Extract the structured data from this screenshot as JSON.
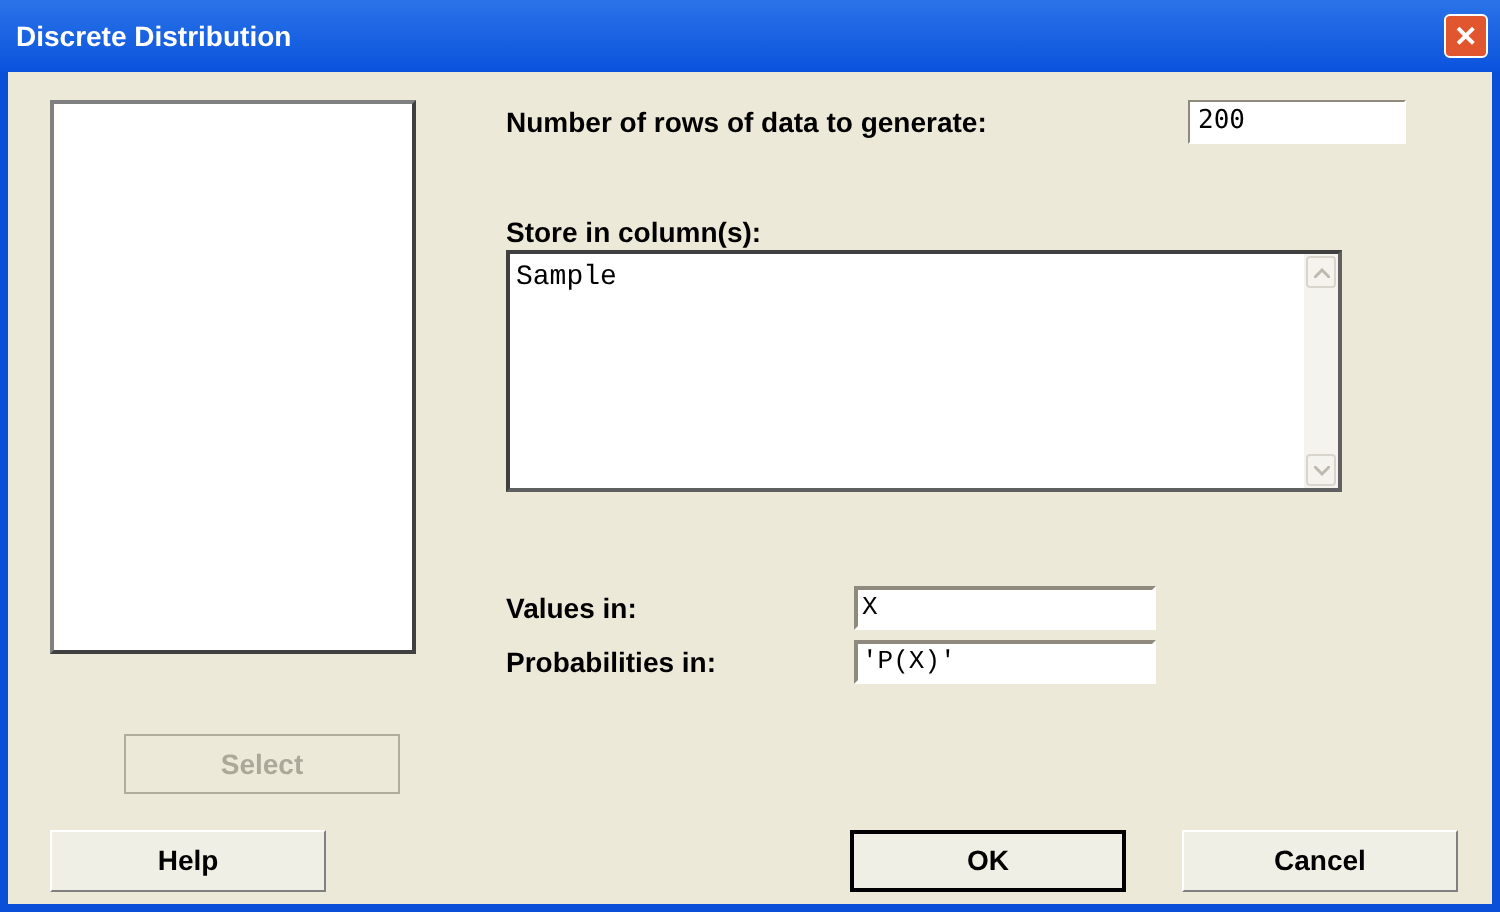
{
  "window": {
    "title": "Discrete Distribution",
    "close": "✕"
  },
  "rows_field": {
    "label": "Number of rows of data to generate:",
    "value": "200"
  },
  "store_field": {
    "label": "Store in column(s):",
    "value": "Sample"
  },
  "values_field": {
    "label": "Values in:",
    "value": "X"
  },
  "probabilities_field": {
    "label": "Probabilities in:",
    "value": "'P(X)'"
  },
  "select_button": {
    "label": "Select",
    "disabled": true
  },
  "buttons": [
    {
      "label": "Help",
      "default": false
    },
    {
      "label": "OK",
      "default": true
    },
    {
      "label": "Cancel",
      "default": false
    }
  ]
}
